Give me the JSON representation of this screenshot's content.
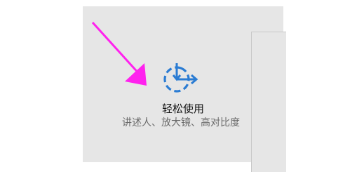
{
  "tile": {
    "icon": "ease-of-access-icon",
    "title": "轻松使用",
    "description": "讲述人、放大镜、高对比度"
  },
  "annotation": {
    "icon": "pointer-arrow-icon",
    "color": "#ff22ee"
  },
  "colors": {
    "tile_background": "#e6e6e6",
    "icon_blue": "#2b7cd3"
  }
}
